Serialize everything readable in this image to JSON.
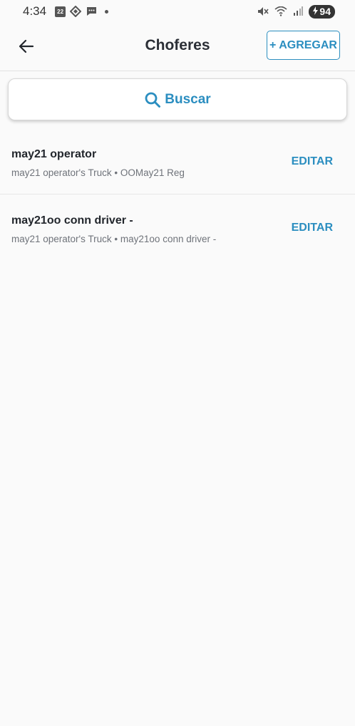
{
  "status_bar": {
    "time": "4:34",
    "calendar_day": "22",
    "battery": "94"
  },
  "header": {
    "title": "Choferes",
    "add_label": "+ AGREGAR"
  },
  "search": {
    "label": "Buscar"
  },
  "drivers": [
    {
      "name": "may21 operator",
      "truck": "may21 operator's Truck",
      "separator": "•",
      "detail": "OOMay21 Reg",
      "edit_label": "EDITAR"
    },
    {
      "name": "may21oo conn driver -",
      "truck": "may21 operator's Truck",
      "separator": "•",
      "detail": "may21oo conn driver -",
      "edit_label": "EDITAR"
    }
  ],
  "colors": {
    "accent": "#2b8ec0",
    "background": "#fafafa",
    "title_text": "#2b2f36"
  }
}
